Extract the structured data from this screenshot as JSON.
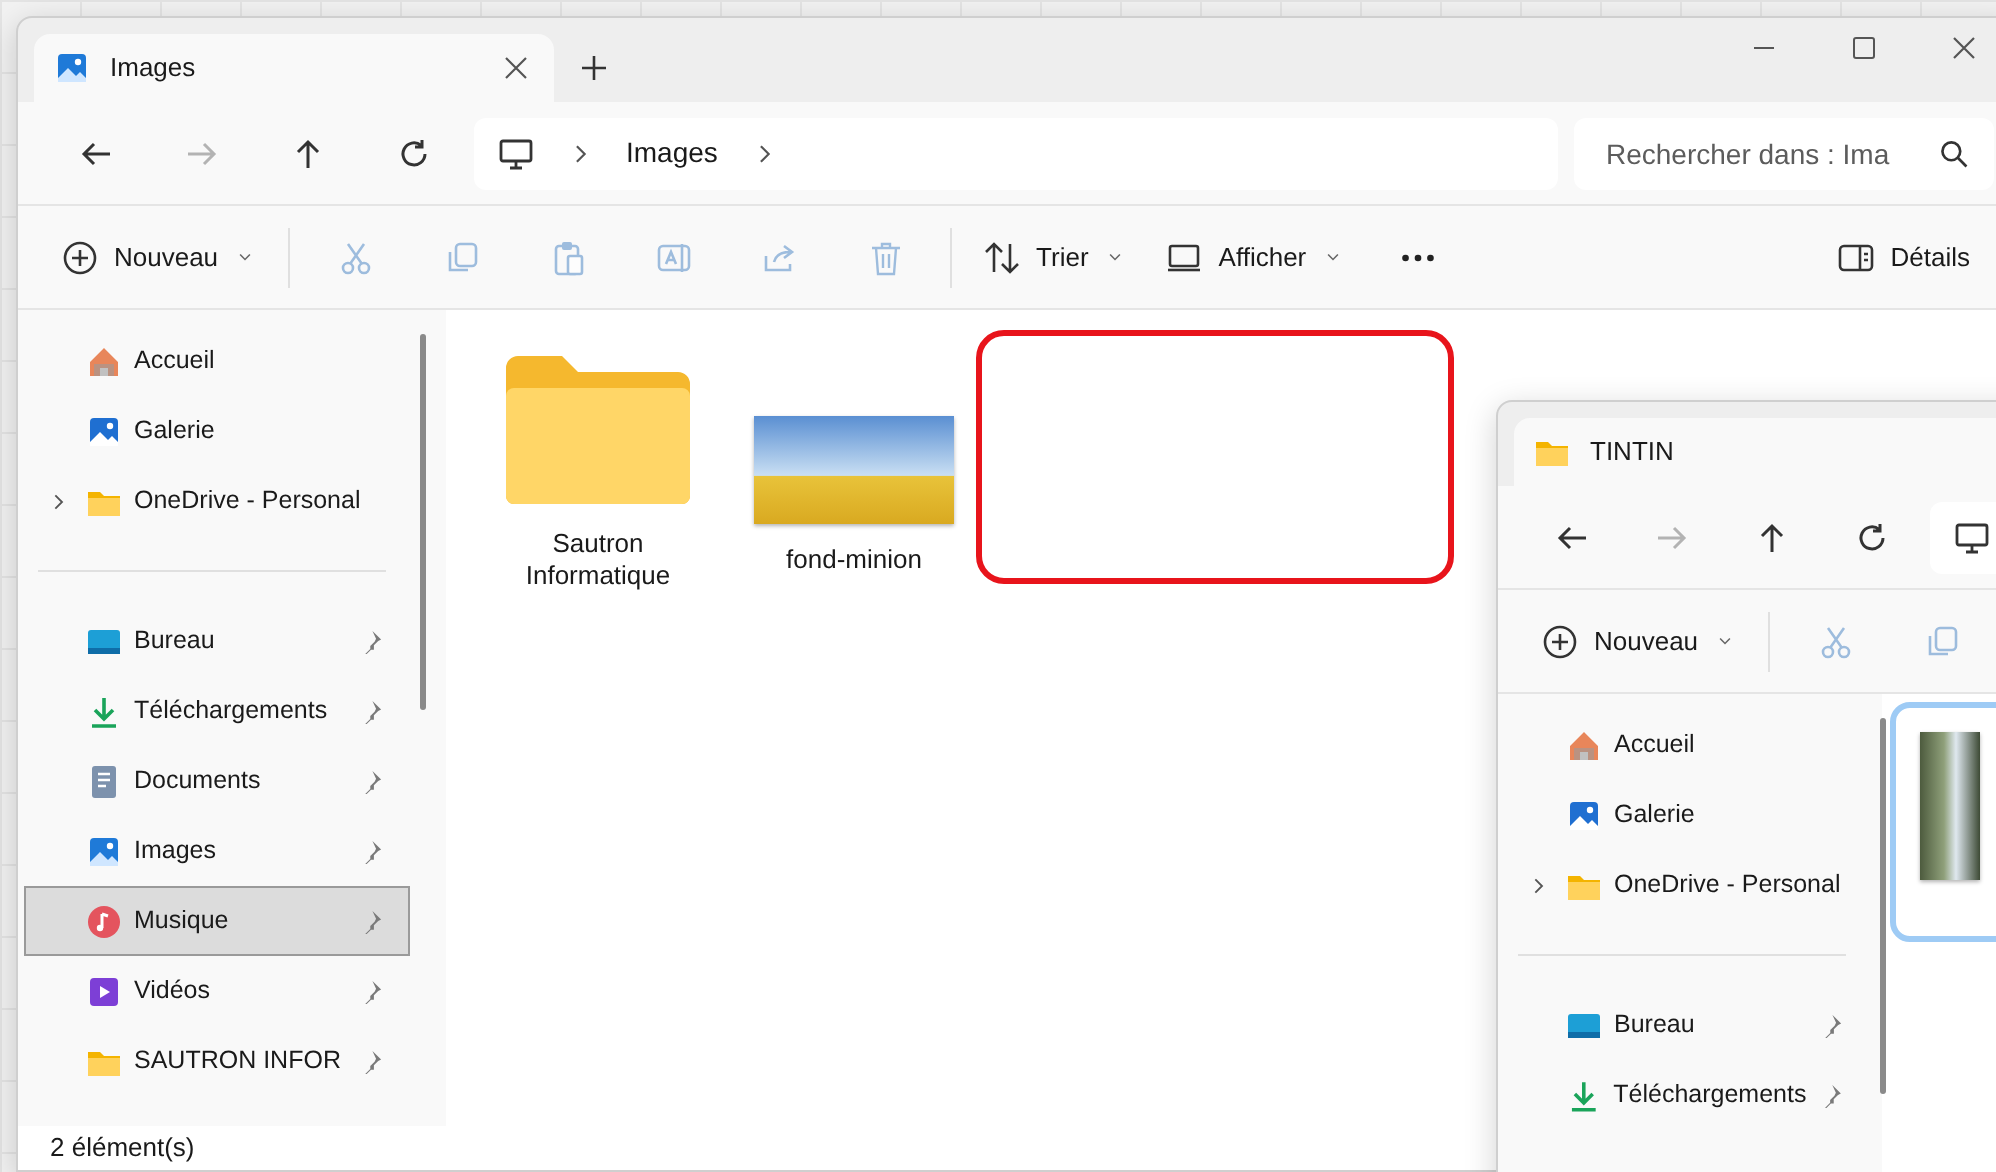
{
  "main_window": {
    "tab": {
      "title": "Images",
      "kind": "image"
    },
    "nav": [
      {
        "kind": "back",
        "disabled": false
      },
      {
        "kind": "forward",
        "disabled": true
      },
      {
        "kind": "up",
        "disabled": false
      },
      {
        "kind": "refresh",
        "disabled": false
      }
    ],
    "breadcrumb": [
      "Images"
    ],
    "search": {
      "placeholder": "Rechercher dans : Ima"
    },
    "toolbar": [
      [
        {
          "kind": "new",
          "label": "Nouveau",
          "dropdown": true,
          "disabled": false
        }
      ],
      [
        {
          "kind": "cut",
          "disabled": true
        },
        {
          "kind": "copy",
          "disabled": true
        },
        {
          "kind": "paste",
          "disabled": true
        },
        {
          "kind": "rename",
          "disabled": true
        },
        {
          "kind": "share",
          "disabled": true
        },
        {
          "kind": "delete",
          "disabled": true
        }
      ],
      [
        {
          "kind": "sort",
          "label": "Trier",
          "dropdown": true,
          "disabled": false
        },
        {
          "kind": "view",
          "label": "Afficher",
          "dropdown": true,
          "disabled": false
        },
        {
          "kind": "more",
          "disabled": false
        }
      ]
    ],
    "details_button": {
      "label": "Détails"
    },
    "sidebar": {
      "items": [
        {
          "label": "Accueil",
          "kind": "home",
          "expandable": false,
          "pinned": false,
          "selected": false
        },
        {
          "label": "Galerie",
          "kind": "gallery",
          "expandable": false,
          "pinned": false,
          "selected": false
        },
        {
          "label": "OneDrive - Personal",
          "kind": "folder",
          "expandable": true,
          "pinned": false,
          "selected": false
        },
        {
          "kind": "divider"
        },
        {
          "label": "Bureau",
          "kind": "desktop",
          "expandable": false,
          "pinned": true,
          "selected": false
        },
        {
          "label": "Téléchargements",
          "kind": "download",
          "expandable": false,
          "pinned": true,
          "selected": false
        },
        {
          "label": "Documents",
          "kind": "document",
          "expandable": false,
          "pinned": true,
          "selected": false
        },
        {
          "label": "Images",
          "kind": "image",
          "expandable": false,
          "pinned": true,
          "selected": false
        },
        {
          "label": "Musique",
          "kind": "music",
          "expandable": false,
          "pinned": true,
          "selected": true
        },
        {
          "label": "Vidéos",
          "kind": "video",
          "expandable": false,
          "pinned": true,
          "selected": false
        },
        {
          "label": "SAUTRON INFOR",
          "kind": "folder",
          "expandable": false,
          "pinned": true,
          "selected": false
        }
      ]
    },
    "files": [
      {
        "name": "Sautron Informatique",
        "kind": "folder"
      },
      {
        "name": "fond-minion",
        "kind": "image"
      }
    ],
    "status_bar": "2 élément(s)"
  },
  "second_window": {
    "tab": {
      "title": "TINTIN",
      "kind": "folder"
    },
    "nav": [
      {
        "kind": "back",
        "disabled": false
      },
      {
        "kind": "forward",
        "disabled": true
      },
      {
        "kind": "up",
        "disabled": false
      },
      {
        "kind": "refresh",
        "disabled": false
      }
    ],
    "toolbar": [
      [
        {
          "kind": "new",
          "label": "Nouveau",
          "dropdown": true,
          "disabled": false
        }
      ],
      [
        {
          "kind": "cut",
          "disabled": true
        },
        {
          "kind": "copy",
          "disabled": true
        }
      ]
    ],
    "sidebar": {
      "items": [
        {
          "label": "Accueil",
          "kind": "home",
          "expandable": false,
          "pinned": false,
          "selected": false
        },
        {
          "label": "Galerie",
          "kind": "gallery",
          "expandable": false,
          "pinned": false,
          "selected": false
        },
        {
          "label": "OneDrive - Personal",
          "kind": "folder",
          "expandable": true,
          "pinned": false,
          "selected": false
        },
        {
          "kind": "divider"
        },
        {
          "label": "Bureau",
          "kind": "desktop",
          "expandable": false,
          "pinned": true,
          "selected": false
        },
        {
          "label": "Téléchargements",
          "kind": "download",
          "expandable": false,
          "pinned": true,
          "selected": false
        }
      ]
    },
    "files": [
      {
        "kind": "image",
        "selected": true
      }
    ]
  }
}
